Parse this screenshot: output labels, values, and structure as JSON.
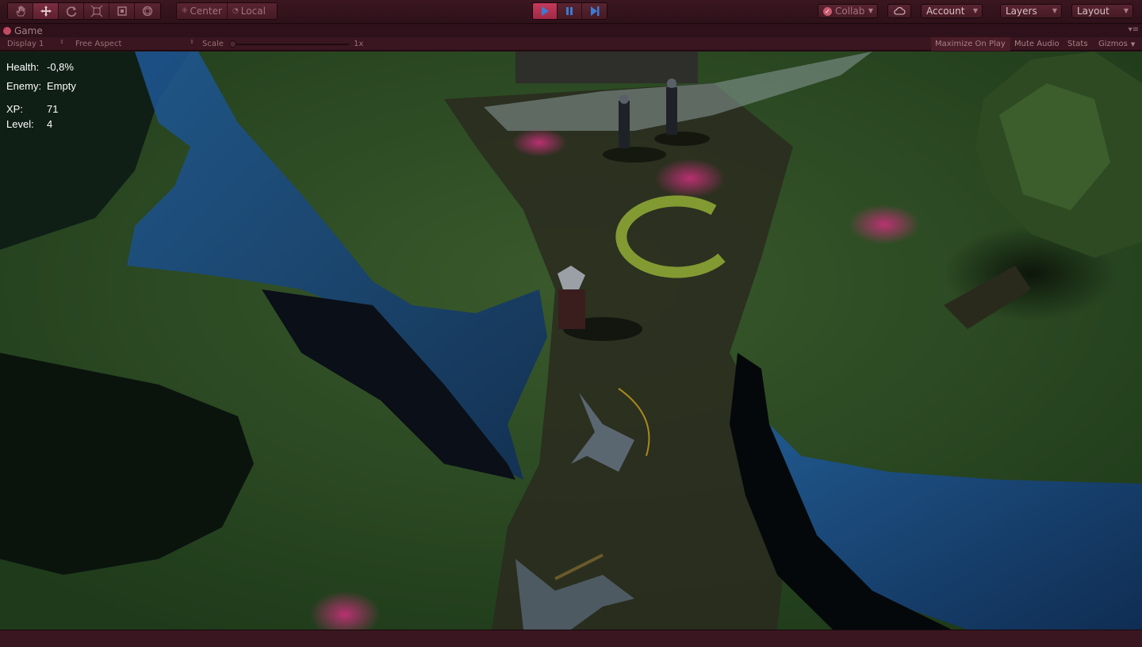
{
  "toolbar": {
    "tools": [
      {
        "icon": "hand-icon"
      },
      {
        "icon": "move-icon"
      },
      {
        "icon": "rotate-icon"
      },
      {
        "icon": "scale-icon"
      },
      {
        "icon": "rect-icon"
      },
      {
        "icon": "transform-icon"
      }
    ],
    "active_tool": "move-icon",
    "pivot_label": "Center",
    "space_label": "Local",
    "play_icons": [
      "play-icon",
      "pause-icon",
      "step-icon"
    ],
    "collab_label": "Collab",
    "account_label": "Account",
    "layers_label": "Layers",
    "layout_label": "Layout"
  },
  "window": {
    "tab_label": "Game"
  },
  "gamebar": {
    "display_label": "Display 1",
    "aspect_label": "Free Aspect",
    "scale_label": "Scale",
    "scale_value": "1x",
    "maximize_label": "Maximize On Play",
    "mute_label": "Mute Audio",
    "stats_label": "Stats",
    "gizmos_label": "Gizmos"
  },
  "hud": {
    "health_label": "Health:",
    "health_value": "-0,8%",
    "enemy_label": "Enemy:",
    "enemy_value": "Empty",
    "xp_label": "XP:",
    "xp_value": "71",
    "level_label": "Level:",
    "level_value": "4"
  },
  "colors": {
    "editor_play_tint": "#3a1620",
    "accent": "#c43a5a",
    "play_icon": "#3a7bd5"
  }
}
